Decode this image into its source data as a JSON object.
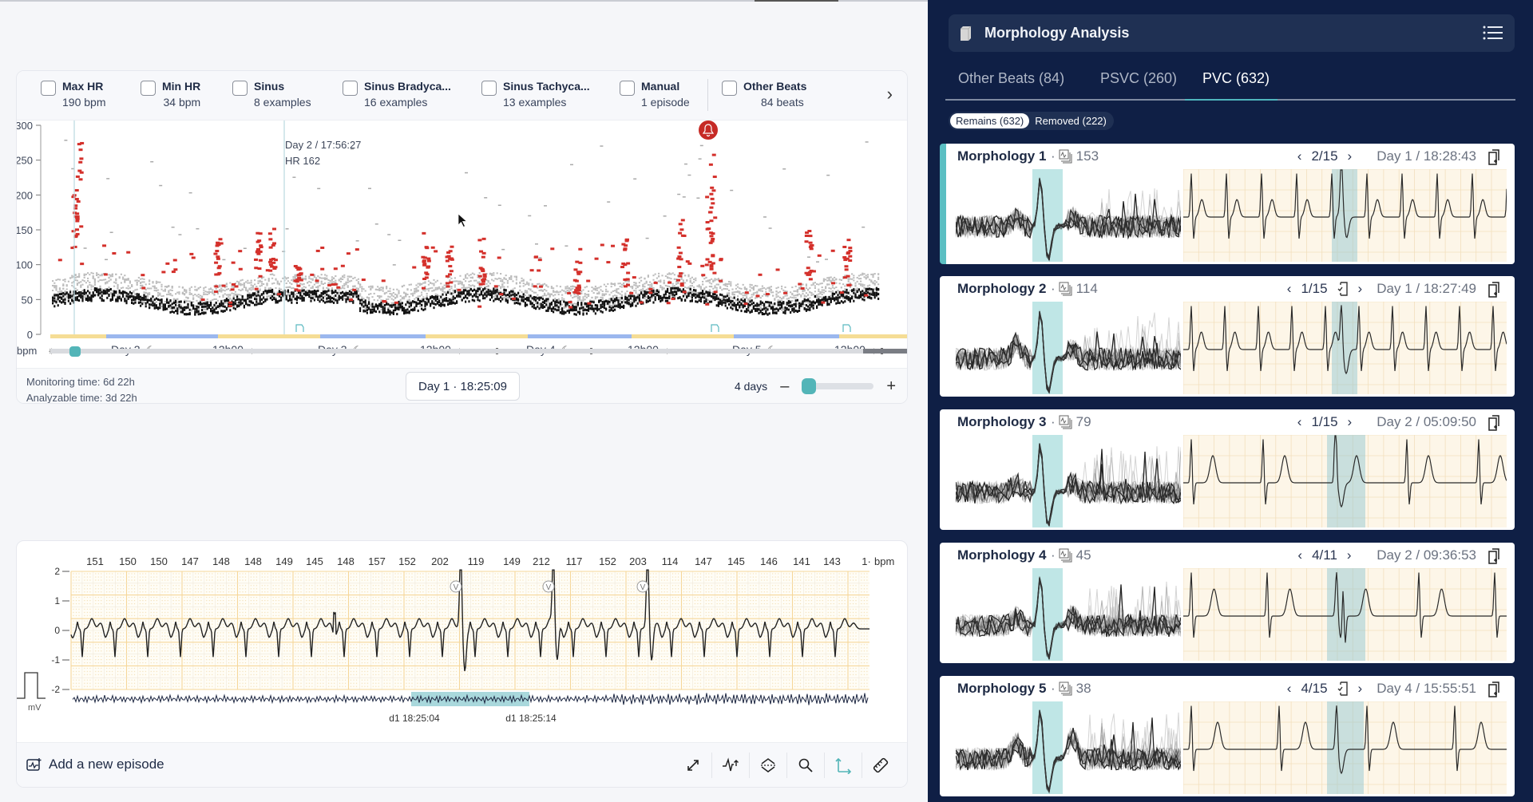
{
  "filters": [
    {
      "label": "Max HR",
      "sub": "190 bpm",
      "checked": false
    },
    {
      "label": "Min HR",
      "sub": "34 bpm",
      "checked": false
    },
    {
      "label": "Sinus",
      "sub": "8 examples",
      "checked": false
    },
    {
      "label": "Sinus Bradyca...",
      "sub": "16 examples",
      "checked": false
    },
    {
      "label": "Sinus Tachyca...",
      "sub": "13 examples",
      "checked": false
    },
    {
      "label": "Manual",
      "sub": "1 episode",
      "checked": false
    },
    {
      "label": "Other Beats",
      "sub": "84 beats",
      "checked": false
    }
  ],
  "trend": {
    "y_unit": "bpm",
    "y_ticks": [
      "300",
      "250",
      "200",
      "150",
      "100",
      "50",
      "0"
    ],
    "day_labels": [
      {
        "text": "Day 2",
        "icon": "moon"
      },
      {
        "text": "12h00",
        "icon": "sun"
      },
      {
        "text": "Day 3",
        "icon": "moon"
      },
      {
        "text": "12h00",
        "icon": "sun"
      },
      {
        "text": "Day 4",
        "icon": "moon"
      },
      {
        "text": "12h00",
        "icon": "sun"
      },
      {
        "text": "Day 5",
        "icon": "moon"
      },
      {
        "text": "12h00",
        "icon": "sun"
      }
    ],
    "tooltip": {
      "line1": "Day 2 / 17:56:27",
      "line2": "HR 162"
    },
    "colors": {
      "normal": "#111111",
      "ectopic": "#d4302b",
      "day": "#f5dd95",
      "night": "#9bb7ee",
      "alarm": "#c62a25",
      "accent": "#53b5b8"
    }
  },
  "trend_footer": {
    "monitoring": "Monitoring time: 6d 22h",
    "analyzable": "Analyzable time: 3d 22h",
    "current_time": "Day 1 · 18:25:09",
    "zoom_label": "4 days",
    "zoom_minus": "–",
    "zoom_plus": "+",
    "zoom_level_fraction": 0.0
  },
  "ecg": {
    "bpm_values": [
      "151",
      "150",
      "150",
      "147",
      "148",
      "148",
      "149",
      "145",
      "148",
      "157",
      "152",
      "202",
      "119",
      "149",
      "212",
      "117",
      "152",
      "203",
      "114",
      "147",
      "145",
      "146",
      "141",
      "143",
      "1·"
    ],
    "bpm_unit": "bpm",
    "y_ticks": [
      "2",
      "1",
      "0",
      "-1",
      "-2"
    ],
    "y_unit": "mV",
    "beat_marker": "V",
    "time_labels": [
      "d1 18:25:04",
      "d1 18:25:14"
    ],
    "add_episode": "Add a new episode",
    "tools": [
      "expand-icon",
      "beat-annotate-icon",
      "amplitude-icon",
      "zoom-icon",
      "axis-icon",
      "ruler-icon"
    ]
  },
  "panel": {
    "title": "Morphology Analysis",
    "tabs": [
      {
        "label": "Other Beats (84)",
        "active": false
      },
      {
        "label": "PSVC (260)",
        "active": false
      },
      {
        "label": "PVC (632)",
        "active": true
      }
    ],
    "pills": [
      {
        "label": "Remains (632)",
        "active": true
      },
      {
        "label": "Removed (222)",
        "active": false
      }
    ],
    "morphologies": [
      {
        "name": "Morphology 1",
        "sep": "·",
        "count": "153",
        "page": "2/15",
        "reviewed": false,
        "time": "Day 1 / 18:28:43",
        "selected": true
      },
      {
        "name": "Morphology 2",
        "sep": "·",
        "count": "114",
        "page": "1/15",
        "reviewed": true,
        "time": "Day 1 / 18:27:49",
        "selected": false
      },
      {
        "name": "Morphology 3",
        "sep": "·",
        "count": "79",
        "page": "1/15",
        "reviewed": false,
        "time": "Day 2 / 05:09:50",
        "selected": false
      },
      {
        "name": "Morphology 4",
        "sep": "·",
        "count": "45",
        "page": "4/11",
        "reviewed": false,
        "time": "Day 2 / 09:36:53",
        "selected": false
      },
      {
        "name": "Morphology 5",
        "sep": "·",
        "count": "38",
        "page": "4/15",
        "reviewed": true,
        "time": "Day 4 / 15:55:51",
        "selected": false
      }
    ]
  }
}
